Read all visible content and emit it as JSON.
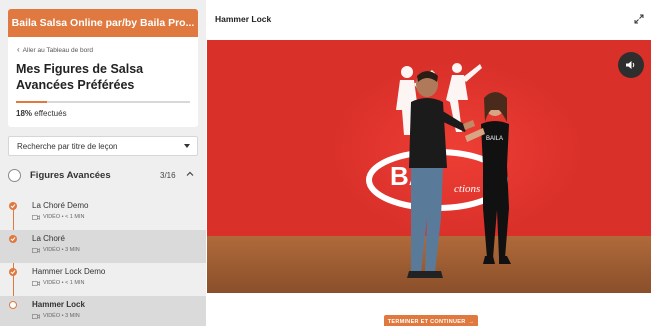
{
  "course": {
    "banner_title": "Baila Salsa Online par/by Baila Pro...",
    "back_link": "Aller au Tableau de bord",
    "title": "Mes Figures de Salsa Avancées Préférées",
    "progress_percent": 18,
    "progress_value": "18%",
    "progress_suffix": "effectués"
  },
  "search": {
    "selected": "Recherche par titre de leçon"
  },
  "section": {
    "title": "Figures Avancées",
    "count": "3/16"
  },
  "lessons": [
    {
      "title": "La Choré Demo",
      "meta": "VIDÉO • < 1 MIN",
      "completed": true,
      "selected": false
    },
    {
      "title": "La Choré",
      "meta": "VIDÉO • 3 MIN",
      "completed": true,
      "selected": true
    },
    {
      "title": "Hammer Lock Demo",
      "meta": "VIDÉO • < 1 MIN",
      "completed": true,
      "selected": false
    },
    {
      "title": "Hammer Lock",
      "meta": "VIDÉO • 3 MIN",
      "completed": false,
      "selected": true
    }
  ],
  "main": {
    "lesson_title": "Hammer Lock",
    "continue_label": "TERMINER ET CONTINUER",
    "continue_arrow": "→"
  },
  "video_logo_text": "BAILA Productions",
  "colors": {
    "accent": "#e0793f",
    "video_wall": "#d9302a",
    "floor": "#a0603a"
  },
  "icons": {
    "back": "chevron-left-icon",
    "expand": "expand-icon",
    "mute": "volume-icon",
    "video": "video-camera-icon"
  }
}
